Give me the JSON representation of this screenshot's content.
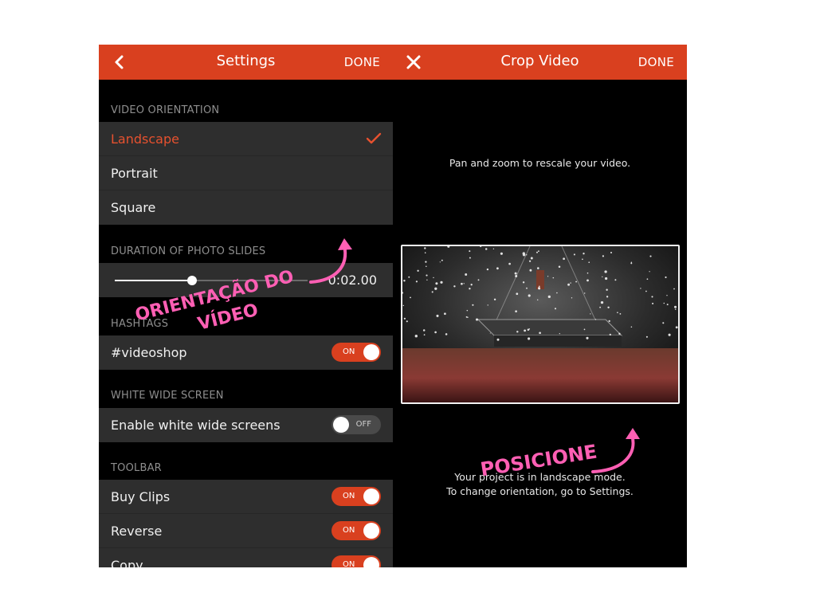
{
  "settings": {
    "title": "Settings",
    "done_label": "DONE",
    "back_icon": "chevron-left-icon",
    "sections": {
      "video_orientation": "VIDEO ORIENTATION",
      "duration": "DURATION OF PHOTO SLIDES",
      "hashtags": "HASHTAGS",
      "white_wide_screen": "WHITE WIDE SCREEN",
      "toolbar": "TOOLBAR"
    },
    "orientation_options": [
      "Landscape",
      "Portrait",
      "Square"
    ],
    "selected_orientation": "Landscape",
    "duration": {
      "value_label": "0:02.00",
      "slider_fraction": 0.4
    },
    "hashtag": {
      "label": "#videoshop",
      "state": "ON"
    },
    "white_wide": {
      "label": "Enable white wide screens",
      "state": "OFF"
    },
    "toolbar_items": [
      {
        "label": "Buy Clips",
        "state": "ON"
      },
      {
        "label": "Reverse",
        "state": "ON"
      },
      {
        "label": "Copy",
        "state": "ON"
      }
    ]
  },
  "crop": {
    "title": "Crop Video",
    "done_label": "DONE",
    "close_icon": "close-icon",
    "instruction": "Pan and zoom to rescale your video.",
    "mode_line1": "Your project is in landscape mode.",
    "mode_line2": "To change orientation, go to Settings."
  },
  "annotations": {
    "orientation_line1": "ORIENTAÇÃO DO",
    "orientation_line2": "VÍDEO",
    "position": "POSICIONE"
  },
  "colors": {
    "accent": "#d9401f",
    "annotation_pink": "#ff5fb4",
    "row_background": "#2e2e2e"
  }
}
